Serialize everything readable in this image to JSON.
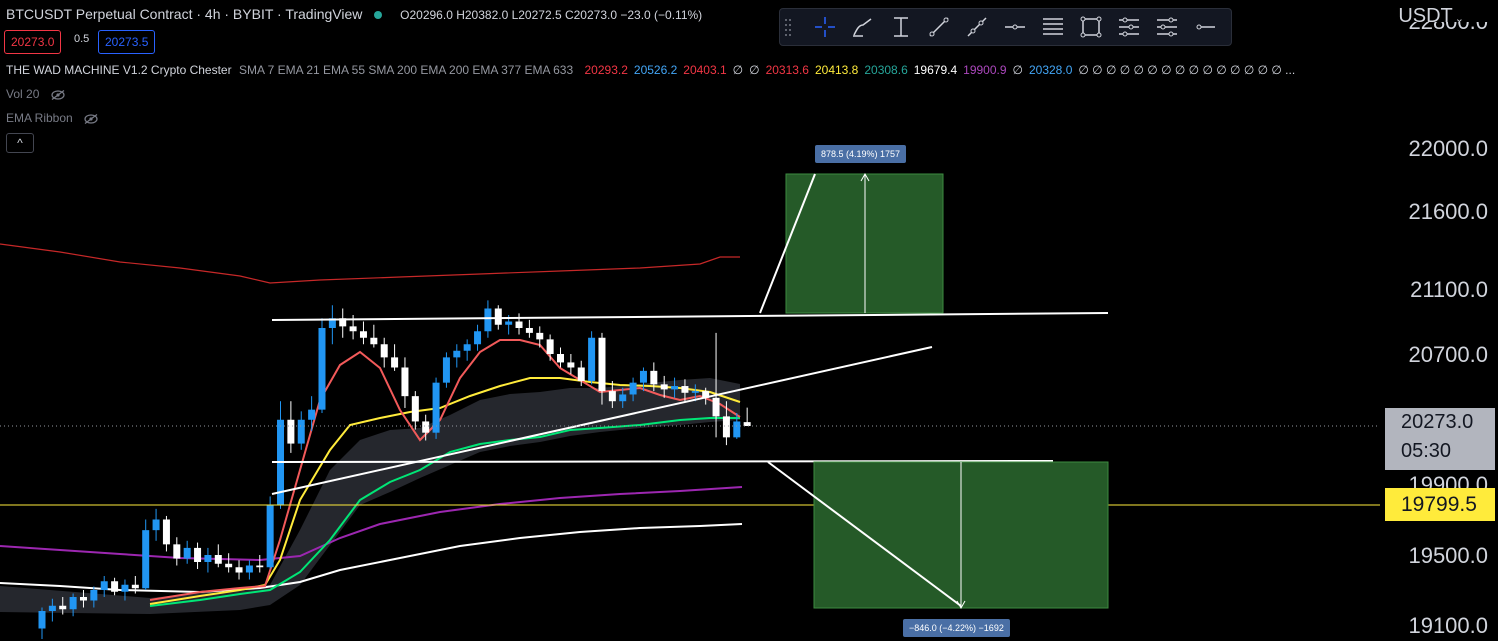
{
  "header": {
    "title": "BTCUSDT Perpetual Contract · 4h · BYBIT · TradingView",
    "ohlc": "O20296.0 H20382.0 L20272.5 C20273.0 −23.0 (−0.11%)",
    "sell_price": "20273.0",
    "spread": "0.5",
    "buy_price": "20273.5"
  },
  "indicator": {
    "name": "THE WAD MACHINE V1.2 Crypto Chester",
    "params": "SMA 7 EMA 21 EMA 55 SMA 200 EMA 200 EMA 377 EMA 633",
    "values": [
      {
        "text": "20293.2",
        "color": "#f23645"
      },
      {
        "text": "20526.2",
        "color": "#42a5f5"
      },
      {
        "text": "20403.1",
        "color": "#f23645"
      },
      {
        "text": "∅",
        "color": "#d1d4dc"
      },
      {
        "text": "∅",
        "color": "#d1d4dc"
      },
      {
        "text": "20313.6",
        "color": "#f23645"
      },
      {
        "text": "20413.8",
        "color": "#ffeb3b"
      },
      {
        "text": "20308.6",
        "color": "#26a69a"
      },
      {
        "text": "19679.4",
        "color": "#ffffff"
      },
      {
        "text": "19900.9",
        "color": "#ab47bc"
      },
      {
        "text": "∅",
        "color": "#d1d4dc"
      },
      {
        "text": "20328.0",
        "color": "#42a5f5"
      },
      {
        "text": "∅ ∅ ∅ ∅ ∅ ∅ ∅ ∅ ∅ ∅ ∅ ∅ ∅ ∅ ∅ ...",
        "color": "#d1d4dc"
      }
    ],
    "vol": "Vol 20",
    "ribbon": "EMA Ribbon",
    "collapse": "^"
  },
  "toolbar": {
    "tools": [
      "crosshair-icon",
      "brush-icon",
      "text-icon",
      "trendline-icon",
      "ray-icon",
      "horizontal-line-icon",
      "fib-icon",
      "rectangle-icon",
      "pitchfork-icon",
      "channel-icon",
      "horizontal-ray-icon"
    ]
  },
  "axis": {
    "currency": "USDT",
    "labels": [
      "22000.0",
      "21600.0",
      "21100.0",
      "20700.0",
      "19500.0",
      "19100.0"
    ],
    "partial_top": "22800.0",
    "partial_19900": "19900.0",
    "current_price": "20273.0",
    "countdown": "05:30",
    "yellow_level": "19799.5"
  },
  "positions": {
    "long_label": "878.5 (4.19%) 1757",
    "short_label": "−846.0 (−4.22%) −1692"
  },
  "colors": {
    "bg": "#000000",
    "up": "#2196f3",
    "down": "#ffffff",
    "sma7": "#f23645",
    "ema21": "#ffeb3b",
    "ema55": "#26a69a",
    "purple": "#9c27b0",
    "white_ma": "#ffffff",
    "red_band": "#c62828",
    "position_fill": "#255a28"
  },
  "chart_data": {
    "type": "candlestick",
    "symbol": "BTCUSDT",
    "timeframe": "4h",
    "ylim": [
      18970,
      22900
    ],
    "yticks": [
      22000,
      21600,
      21100,
      20700,
      20273,
      19900,
      19799.5,
      19500,
      19100
    ],
    "candles": [
      [
        19080,
        19200,
        19020,
        19180
      ],
      [
        19180,
        19250,
        19120,
        19210
      ],
      [
        19210,
        19260,
        19160,
        19190
      ],
      [
        19190,
        19280,
        19150,
        19260
      ],
      [
        19260,
        19300,
        19200,
        19240
      ],
      [
        19240,
        19320,
        19200,
        19300
      ],
      [
        19300,
        19380,
        19260,
        19350
      ],
      [
        19350,
        19370,
        19270,
        19290
      ],
      [
        19290,
        19360,
        19240,
        19330
      ],
      [
        19330,
        19380,
        19280,
        19310
      ],
      [
        19310,
        19700,
        19300,
        19640
      ],
      [
        19640,
        19760,
        19580,
        19700
      ],
      [
        19700,
        19720,
        19520,
        19560
      ],
      [
        19560,
        19600,
        19440,
        19480
      ],
      [
        19480,
        19580,
        19450,
        19540
      ],
      [
        19540,
        19570,
        19420,
        19460
      ],
      [
        19460,
        19540,
        19400,
        19500
      ],
      [
        19500,
        19560,
        19430,
        19450
      ],
      [
        19450,
        19510,
        19400,
        19430
      ],
      [
        19430,
        19470,
        19360,
        19400
      ],
      [
        19400,
        19470,
        19360,
        19440
      ],
      [
        19440,
        19500,
        19400,
        19430
      ],
      [
        19430,
        19830,
        19420,
        19780
      ],
      [
        19780,
        20420,
        19760,
        20310
      ],
      [
        20310,
        20420,
        20100,
        20160
      ],
      [
        20160,
        20360,
        20120,
        20310
      ],
      [
        20310,
        20450,
        20240,
        20370
      ],
      [
        20370,
        20920,
        20350,
        20860
      ],
      [
        20860,
        21000,
        20760,
        20920
      ],
      [
        20920,
        20980,
        20800,
        20870
      ],
      [
        20870,
        20940,
        20790,
        20840
      ],
      [
        20840,
        20900,
        20760,
        20800
      ],
      [
        20800,
        20880,
        20740,
        20760
      ],
      [
        20760,
        20800,
        20620,
        20680
      ],
      [
        20680,
        20760,
        20600,
        20620
      ],
      [
        20620,
        20680,
        20380,
        20450
      ],
      [
        20450,
        20480,
        20250,
        20300
      ],
      [
        20300,
        20340,
        20180,
        20230
      ],
      [
        20230,
        20560,
        20190,
        20530
      ],
      [
        20530,
        20710,
        20500,
        20680
      ],
      [
        20680,
        20760,
        20620,
        20720
      ],
      [
        20720,
        20790,
        20660,
        20760
      ],
      [
        20760,
        20880,
        20720,
        20840
      ],
      [
        20840,
        21030,
        20800,
        20980
      ],
      [
        20980,
        21000,
        20850,
        20880
      ],
      [
        20880,
        20940,
        20820,
        20900
      ],
      [
        20900,
        20950,
        20820,
        20860
      ],
      [
        20860,
        20910,
        20800,
        20830
      ],
      [
        20830,
        20870,
        20740,
        20790
      ],
      [
        20790,
        20820,
        20660,
        20700
      ],
      [
        20700,
        20740,
        20620,
        20650
      ],
      [
        20650,
        20700,
        20580,
        20620
      ],
      [
        20620,
        20660,
        20510,
        20540
      ],
      [
        20540,
        20840,
        20520,
        20800
      ],
      [
        20800,
        20830,
        20400,
        20480
      ],
      [
        20480,
        20540,
        20380,
        20420
      ],
      [
        20420,
        20500,
        20380,
        20460
      ],
      [
        20460,
        20560,
        20420,
        20530
      ],
      [
        20530,
        20620,
        20480,
        20600
      ],
      [
        20600,
        20650,
        20480,
        20520
      ],
      [
        20520,
        20570,
        20440,
        20490
      ],
      [
        20490,
        20560,
        20440,
        20510
      ],
      [
        20510,
        20550,
        20420,
        20470
      ],
      [
        20470,
        20520,
        20420,
        20480
      ],
      [
        20480,
        20500,
        20400,
        20440
      ],
      [
        20440,
        20830,
        20200,
        20330
      ],
      [
        20330,
        20420,
        20150,
        20200
      ],
      [
        20200,
        20350,
        20190,
        20300
      ],
      [
        20296,
        20382,
        20272.5,
        20273
      ]
    ],
    "moving_averages": [
      {
        "name": "SMA 7",
        "color": "#f23645",
        "last": 20293.2
      },
      {
        "name": "EMA 21",
        "color": "#ffeb3b",
        "last": 20413.8
      },
      {
        "name": "EMA 55",
        "color": "#26a69a",
        "last": 20308.6
      },
      {
        "name": "SMA 200",
        "color": "#ab47bc",
        "last": 19900.9
      },
      {
        "name": "EMA 200",
        "color": "#ffffff",
        "last": 19679.4
      }
    ],
    "long_position": {
      "entry": 21100,
      "target": 21850,
      "label": "878.5 (4.19%) 1757"
    },
    "short_position": {
      "entry": 20180,
      "stop": 19110,
      "label": "−846.0 (−4.22%) −1692"
    }
  }
}
